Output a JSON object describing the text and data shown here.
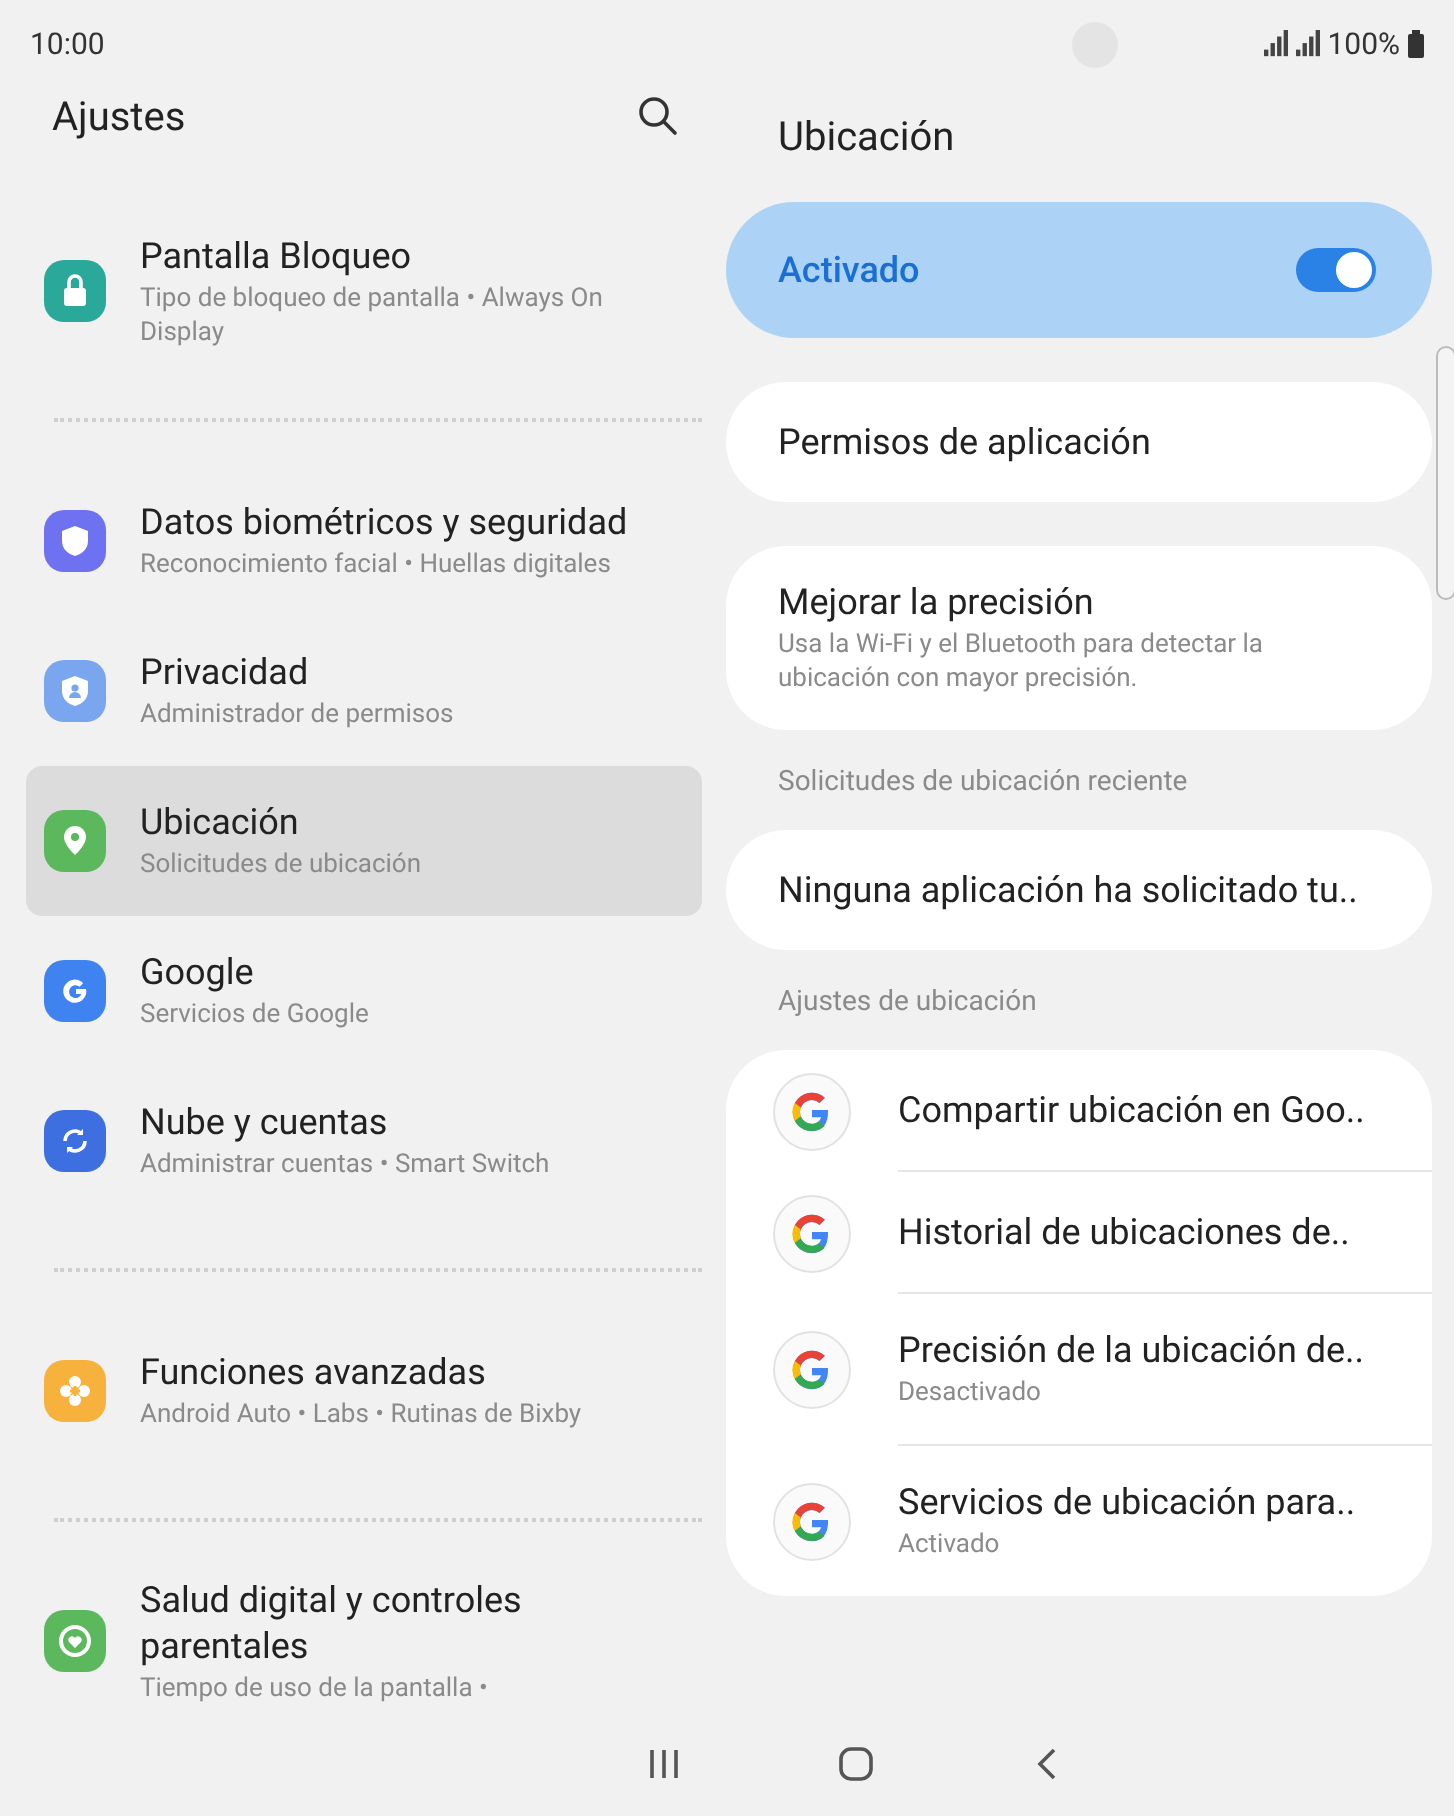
{
  "status_bar": {
    "time": "10:00",
    "battery": "100%"
  },
  "settings_list": {
    "title": "Ajustes",
    "groups": [
      {
        "items": [
          {
            "title": "Pantalla Bloqueo",
            "subtitle": "Tipo de bloqueo de pantalla  •  Always On Display",
            "selected": false
          }
        ]
      },
      {
        "items": [
          {
            "title": "Datos biométricos y seguridad",
            "subtitle": "Reconocimiento facial  •  Huellas digitales",
            "selected": false
          },
          {
            "title": "Privacidad",
            "subtitle": "Administrador de permisos",
            "selected": false
          },
          {
            "title": "Ubicación",
            "subtitle": "Solicitudes de ubicación",
            "selected": true
          },
          {
            "title": "Google",
            "subtitle": "Servicios de Google",
            "selected": false
          },
          {
            "title": "Nube y cuentas",
            "subtitle": "Administrar cuentas  •  Smart Switch",
            "selected": false
          }
        ]
      },
      {
        "items": [
          {
            "title": "Funciones avanzadas",
            "subtitle": "Android Auto  •  Labs  •  Rutinas de Bixby",
            "selected": false
          }
        ]
      },
      {
        "items": [
          {
            "title": "Salud digital y controles parentales",
            "subtitle": "Tiempo de uso de la pantalla  •",
            "selected": false
          }
        ]
      }
    ]
  },
  "detail": {
    "title": "Ubicación",
    "main_switch": {
      "label": "Activado",
      "on": true
    },
    "sections": [
      {
        "items": [
          {
            "kind": "plain",
            "title": "Permisos de aplicación"
          }
        ]
      },
      {
        "items": [
          {
            "kind": "plain",
            "title": "Mejorar la precisión",
            "subtitle": "Usa la Wi-Fi y el Bluetooth para detectar la ubicación con mayor precisión."
          }
        ]
      },
      {
        "header": "Solicitudes de ubicación reciente",
        "items": [
          {
            "kind": "plain",
            "title": "Ninguna aplicación ha solicitado tu.."
          }
        ]
      },
      {
        "header": "Ajustes de ubicación",
        "items": [
          {
            "kind": "app",
            "title": "Compartir ubicación en Goo.."
          },
          {
            "kind": "app",
            "title": "Historial de ubicaciones de.."
          },
          {
            "kind": "app",
            "title": "Precisión de la ubicación de..",
            "subtitle": "Desactivado"
          },
          {
            "kind": "app",
            "title": "Servicios de ubicación para..",
            "subtitle": "Activado"
          }
        ]
      }
    ]
  }
}
